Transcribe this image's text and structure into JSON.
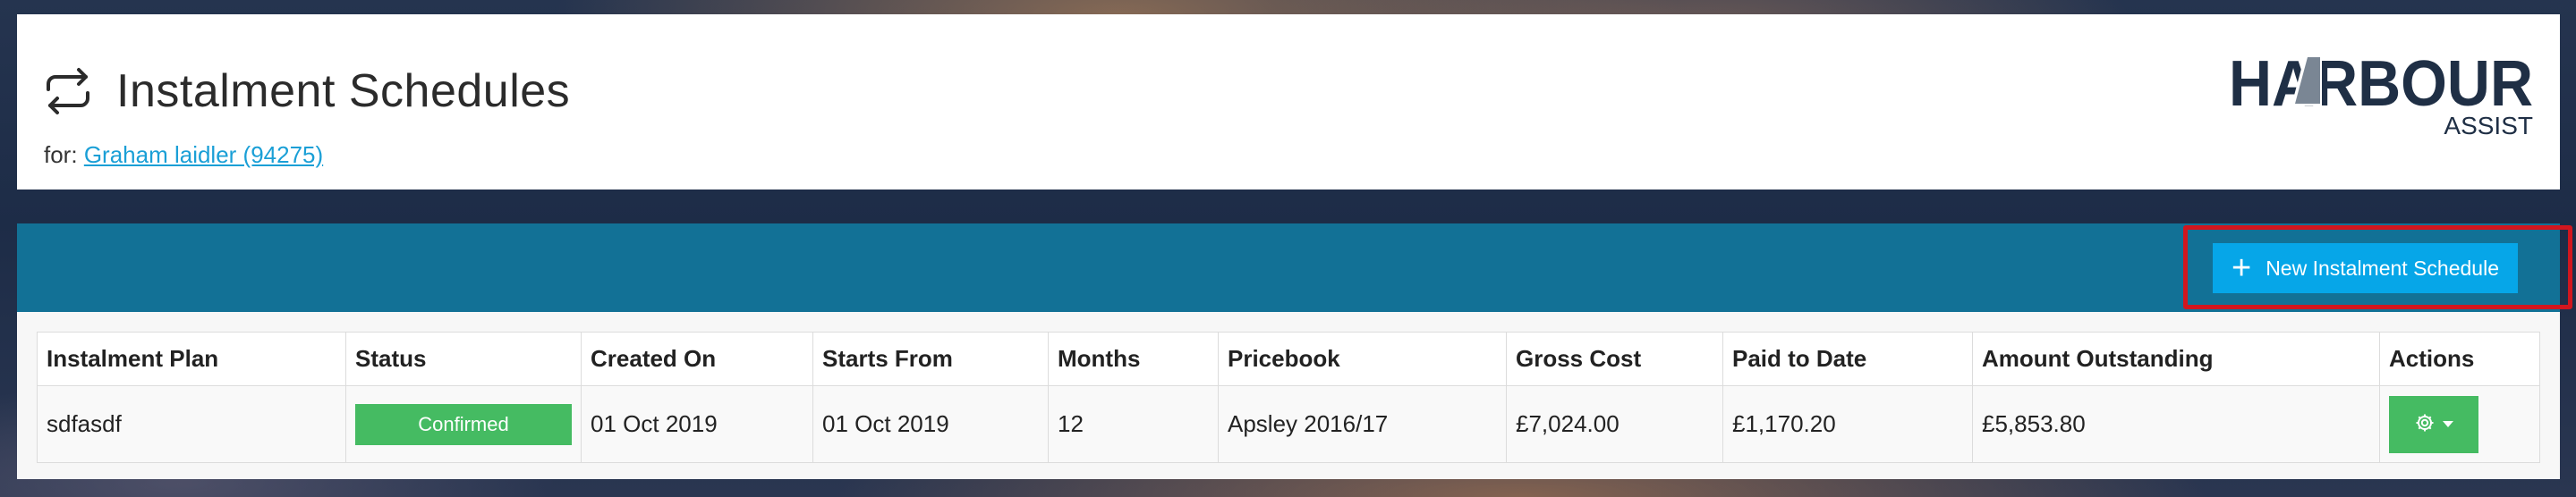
{
  "header": {
    "title": "Instalment Schedules",
    "for_label": "for:",
    "client_link": "Graham laidler (94275)",
    "logo": {
      "main": "HARBOUR",
      "sub": "ASSIST"
    }
  },
  "toolbar": {
    "new_button_label": "New Instalment Schedule"
  },
  "table": {
    "columns": [
      "Instalment Plan",
      "Status",
      "Created On",
      "Starts From",
      "Months",
      "Pricebook",
      "Gross Cost",
      "Paid to Date",
      "Amount Outstanding",
      "Actions"
    ],
    "rows": [
      {
        "plan": "sdfasdf",
        "status": "Confirmed",
        "created_on": "01 Oct 2019",
        "starts_from": "01 Oct 2019",
        "months": "12",
        "pricebook": "Apsley 2016/17",
        "gross_cost": "£7,024.00",
        "paid_to_date": "£1,170.20",
        "amount_outstanding": "£5,853.80"
      }
    ]
  },
  "colors": {
    "toolbar": "#127196",
    "primary_button": "#06a6e8",
    "success": "#45bb62",
    "highlight": "#d2161e",
    "link": "#1a9fd6"
  },
  "icons": {
    "title": "refresh-cycle-icon",
    "new": "plus-icon",
    "actions": "gear-icon"
  }
}
